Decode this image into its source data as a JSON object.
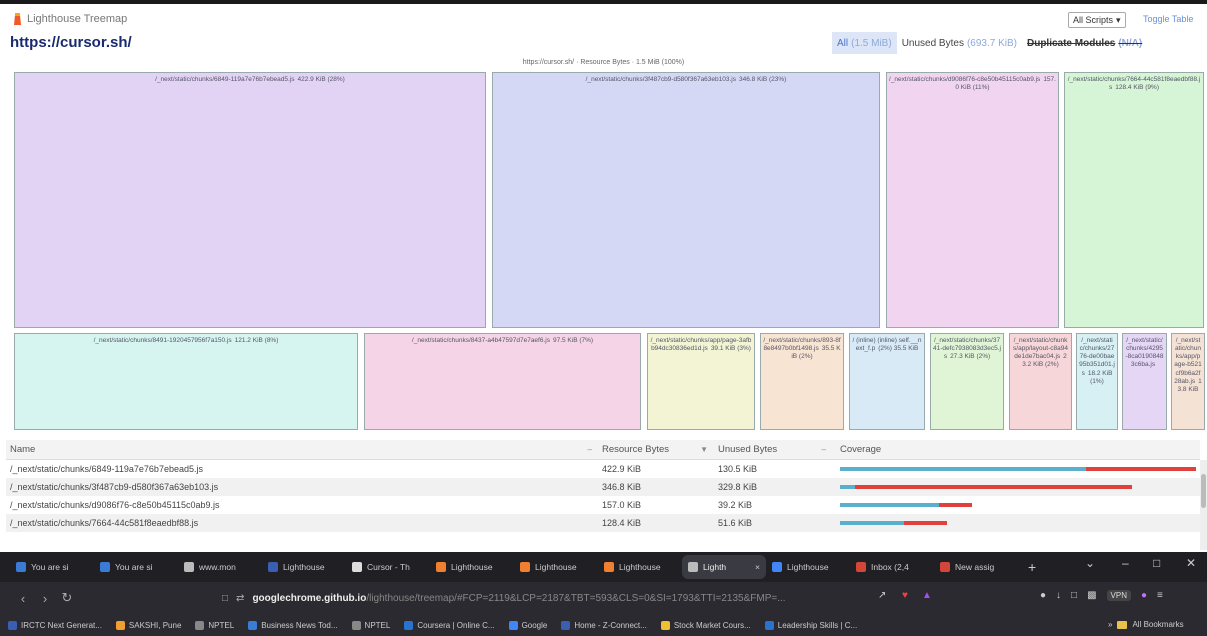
{
  "header": {
    "app_title": "Lighthouse Treemap",
    "url": "https://cursor.sh/",
    "scripts_select": "All Scripts",
    "toggle_table": "Toggle Table",
    "modes": [
      {
        "label": "All",
        "sub": "(1.5 MiB)",
        "state": "active"
      },
      {
        "label": "Unused Bytes",
        "sub": "(693.7 KiB)",
        "state": "normal"
      },
      {
        "label": "Duplicate Modules",
        "sub": "(N/A)",
        "state": "disabled"
      }
    ]
  },
  "treemap": {
    "header": "https://cursor.sh/ · Resource Bytes · 1.5 MiB (100%)",
    "cells": [
      {
        "name": "/_next/static/chunks/6849-119a7e76b7ebead5.js",
        "size": "422.9 KiB (28%)",
        "color": "#e2d3f4"
      },
      {
        "name": "/_next/static/chunks/3f487cb9-d580f367a63eb103.js",
        "size": "346.8 KiB (23%)",
        "color": "#d4d8f4"
      },
      {
        "name": "/_next/static/chunks/d9086f76-c8e50b45115c0ab9.js",
        "size": "157.0 KiB (11%)",
        "color": "#f0d4f0"
      },
      {
        "name": "/_next/static/chunks/7664-44c581f8eaedbf88.js",
        "size": "128.4 KiB (9%)",
        "color": "#d6f4d6"
      },
      {
        "name": "/_next/static/chunks/8491-1920457956f7a150.js",
        "size": "121.2 KiB (8%)",
        "color": "#d6f4f0"
      },
      {
        "name": "/_next/static/chunks/8437-a4b47597d7e7aef6.js",
        "size": "97.5 KiB (7%)",
        "color": "#f4d4e6"
      },
      {
        "name": "/_next/static/chunks/app/page-3afbb94dc30836ed1d.js",
        "size": "39.1 KiB (3%)",
        "color": "#f2f4d4"
      },
      {
        "name": "/_next/static/chunks/893-8f8e8497b0bf1498.js",
        "size": "35.5 KiB (2%)",
        "color": "#f8e4d2"
      },
      {
        "name": "/ (inline) (inline) self.__next_f.p",
        "size": "(2%) 35.5 KiB",
        "color": "#d8eaf6"
      },
      {
        "name": "/_next/static/chunks/3741-defc7938083d3ec5.js",
        "size": "27.3 KiB (2%)",
        "color": "#e0f4d6"
      },
      {
        "name": "/_next/static/chunks/app/layout-c8a94de1de7bac04.js",
        "size": "23.2 KiB (2%)",
        "color": "#f6d6d8"
      },
      {
        "name": "/_next/static/chunks/2776-de00bae95b351d01.js",
        "size": "18.2 KiB (1%)",
        "color": "#d6f0f4"
      },
      {
        "name": "/_next/static/chunks/4295-8ca01908483c6ba.js",
        "size": "",
        "color": "#e4d6f4"
      },
      {
        "name": "/_next/static/chunks/app/page-b521cf9b6a2f28ab.js",
        "size": "13.8 KiB",
        "color": "#f4e2d4"
      }
    ]
  },
  "table": {
    "columns": [
      "Name",
      "Resource Bytes",
      "Unused Bytes",
      "Coverage"
    ],
    "rows": [
      {
        "name": "/_next/static/chunks/6849-119a7e76b7ebead5.js",
        "resource": "422.9 KiB",
        "unused": "130.5 KiB",
        "used_frac": 0.69,
        "unused_frac": 0.31,
        "scale": 1.0
      },
      {
        "name": "/_next/static/chunks/3f487cb9-d580f367a63eb103.js",
        "resource": "346.8 KiB",
        "unused": "329.8 KiB",
        "used_frac": 0.05,
        "unused_frac": 0.95,
        "scale": 0.82
      },
      {
        "name": "/_next/static/chunks/d9086f76-c8e50b45115c0ab9.js",
        "resource": "157.0 KiB",
        "unused": "39.2 KiB",
        "used_frac": 0.75,
        "unused_frac": 0.25,
        "scale": 0.37
      },
      {
        "name": "/_next/static/chunks/7664-44c581f8eaedbf88.js",
        "resource": "128.4 KiB",
        "unused": "51.6 KiB",
        "used_frac": 0.6,
        "unused_frac": 0.4,
        "scale": 0.3
      }
    ]
  },
  "browser": {
    "tabs": [
      {
        "label": "You are si",
        "color": "#3a7bd5"
      },
      {
        "label": "You are si",
        "color": "#3a7bd5"
      },
      {
        "label": "www.mon",
        "color": "#bbbbbb"
      },
      {
        "label": "Lighthouse",
        "color": "#3a5fb0"
      },
      {
        "label": "Cursor - Th",
        "color": "#dddddd"
      },
      {
        "label": "Lighthouse",
        "color": "#f08030"
      },
      {
        "label": "Lighthouse",
        "color": "#f08030"
      },
      {
        "label": "Lighthouse",
        "color": "#f08030"
      },
      {
        "label": "Lighth",
        "color": "#bbbbbb",
        "active": true
      },
      {
        "label": "Lighthouse",
        "color": "#4285f4"
      },
      {
        "label": "Inbox (2,4",
        "color": "#d44638"
      },
      {
        "label": "New assig",
        "color": "#d44638"
      }
    ],
    "new_tab": "+",
    "close_tab": "×",
    "omnibox_host": "googlechrome.github.io",
    "omnibox_path": "/lighthouse/treemap/#FCP=2119&LCP=2187&TBT=593&CLS=0&SI=1793&TTI=2135&FMP=...",
    "vpn": "VPN",
    "bookmarks": [
      {
        "label": "IRCTC Next Generat...",
        "color": "#3a5fb0"
      },
      {
        "label": "SAKSHI, Pune",
        "color": "#f0a030"
      },
      {
        "label": "NPTEL",
        "color": "#888888"
      },
      {
        "label": "Business News Tod...",
        "color": "#3a7bd5"
      },
      {
        "label": "NPTEL",
        "color": "#888888"
      },
      {
        "label": "Coursera | Online C...",
        "color": "#2a73cc"
      },
      {
        "label": "Google",
        "color": "#4285f4"
      },
      {
        "label": "Home - Z-Connect...",
        "color": "#3a5fb0"
      },
      {
        "label": "Stock Market Cours...",
        "color": "#f0c030"
      },
      {
        "label": "Leadership Skills | C...",
        "color": "#2a73cc"
      }
    ],
    "all_bookmarks": "All Bookmarks"
  }
}
